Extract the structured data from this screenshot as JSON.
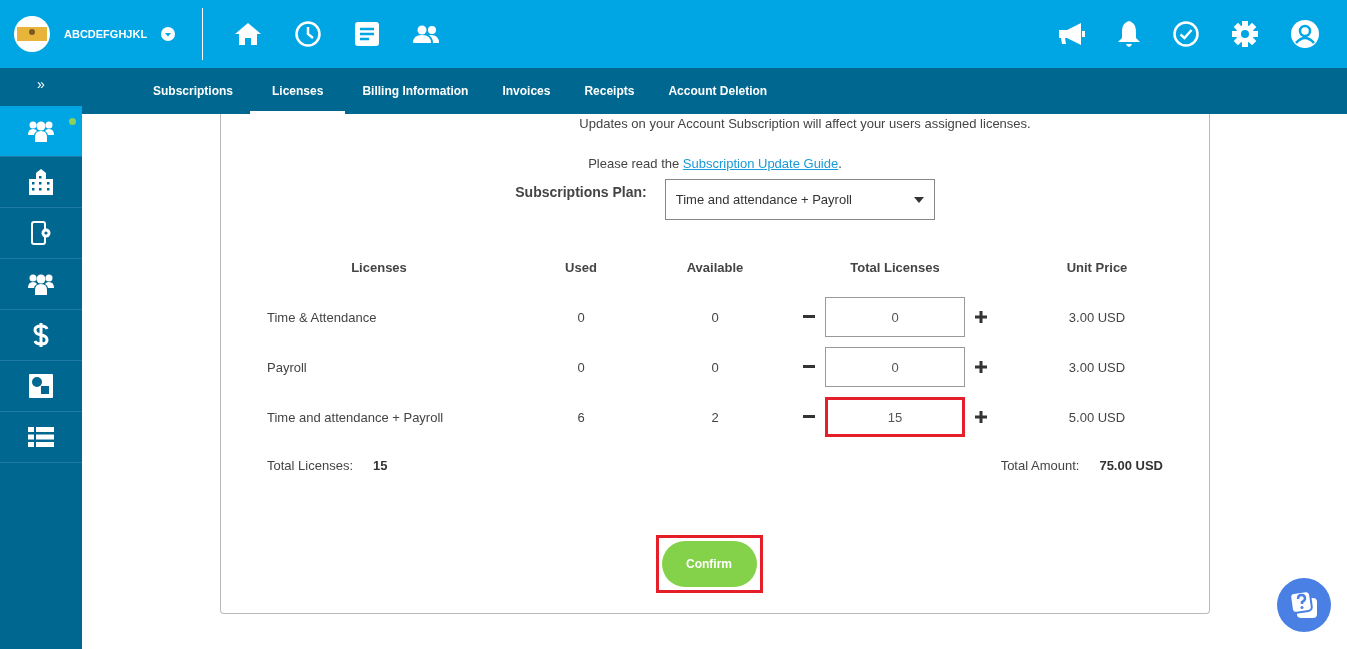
{
  "header": {
    "company_name": "ABCDEFGHJKL"
  },
  "tabs": [
    {
      "label": "Subscriptions",
      "selected": false
    },
    {
      "label": "Licenses",
      "selected": true
    },
    {
      "label": "Billing Information",
      "selected": false
    },
    {
      "label": "Invoices",
      "selected": false
    },
    {
      "label": "Receipts",
      "selected": false
    },
    {
      "label": "Account Deletion",
      "selected": false
    }
  ],
  "sidebar": {
    "toggle": "»",
    "items": [
      {
        "kind": "users",
        "selected": true,
        "notification": true
      },
      {
        "kind": "building",
        "selected": false,
        "notification": false
      },
      {
        "kind": "device",
        "selected": false,
        "notification": false
      },
      {
        "kind": "users",
        "selected": false,
        "notification": false
      },
      {
        "kind": "dollar",
        "selected": false,
        "notification": false
      },
      {
        "kind": "shapes",
        "selected": false,
        "notification": false
      },
      {
        "kind": "list",
        "selected": false,
        "notification": false
      }
    ]
  },
  "notice": "Updates on your Account Subscription will affect your users assigned licenses.",
  "guide": {
    "prefix": "Please read the ",
    "link": "Subscription Update Guide",
    "suffix": "."
  },
  "plan": {
    "label": "Subscriptions Plan:",
    "value": "Time and attendance + Payroll"
  },
  "table": {
    "columns": [
      "Licenses",
      "Used",
      "Available",
      "Total Licenses",
      "Unit Price"
    ],
    "rows": [
      {
        "name": "Time & Attendance",
        "used": "0",
        "available": "0",
        "total": "0",
        "unit_price": "3.00 USD",
        "highlighted": false
      },
      {
        "name": "Payroll",
        "used": "0",
        "available": "0",
        "total": "0",
        "unit_price": "3.00 USD",
        "highlighted": false
      },
      {
        "name": "Time and attendance + Payroll",
        "used": "6",
        "available": "2",
        "total": "15",
        "unit_price": "5.00 USD",
        "highlighted": true
      }
    ]
  },
  "totals": {
    "licenses_label": "Total Licenses:",
    "licenses_value": "15",
    "amount_label": "Total Amount:",
    "amount_value": "75.00 USD"
  },
  "confirm": {
    "label": "Confirm",
    "highlighted": true
  }
}
